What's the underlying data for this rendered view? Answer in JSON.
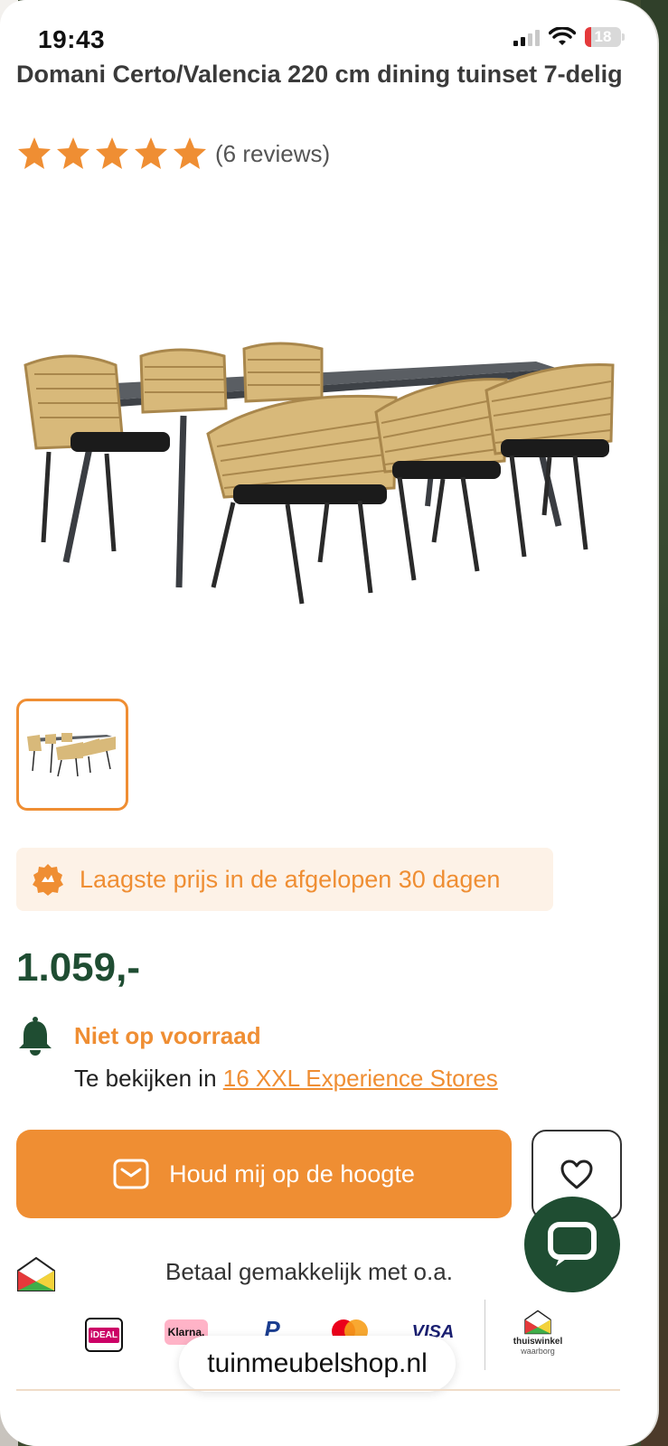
{
  "status_bar": {
    "time": "19:43",
    "battery": "18",
    "battery_level": 0.18
  },
  "product": {
    "title": "Domani Certo/Valencia 220 cm dining tuinset 7-delig",
    "rating": 5,
    "reviews": "(6 reviews)",
    "image_alt": "dining-set-image"
  },
  "promo": {
    "text": "Laagste prijs in de afgelopen 30 dagen"
  },
  "price": "1.059,-",
  "stock": {
    "label": "Niet op voorraad",
    "stores_prefix": "Te bekijken in ",
    "stores_link": "16 XXL Experience Stores"
  },
  "actions": {
    "notify_label": "Houd mij op de hoogte"
  },
  "payment": {
    "text": "Betaal gemakkelijk met o.a.",
    "logos": {
      "ideal": "iDEAL",
      "klarna": "Klarna.",
      "paypal": "P",
      "visa": "VISA",
      "thuiswinkel_line1": "thuiswinkel",
      "thuiswinkel_line2": "waarborg"
    }
  },
  "browser": {
    "url": "tuinmeubelshop.nl"
  },
  "colors": {
    "accent": "#ef8e33",
    "brand_green": "#1f4d32",
    "promo_bg": "#fdf2e7"
  }
}
